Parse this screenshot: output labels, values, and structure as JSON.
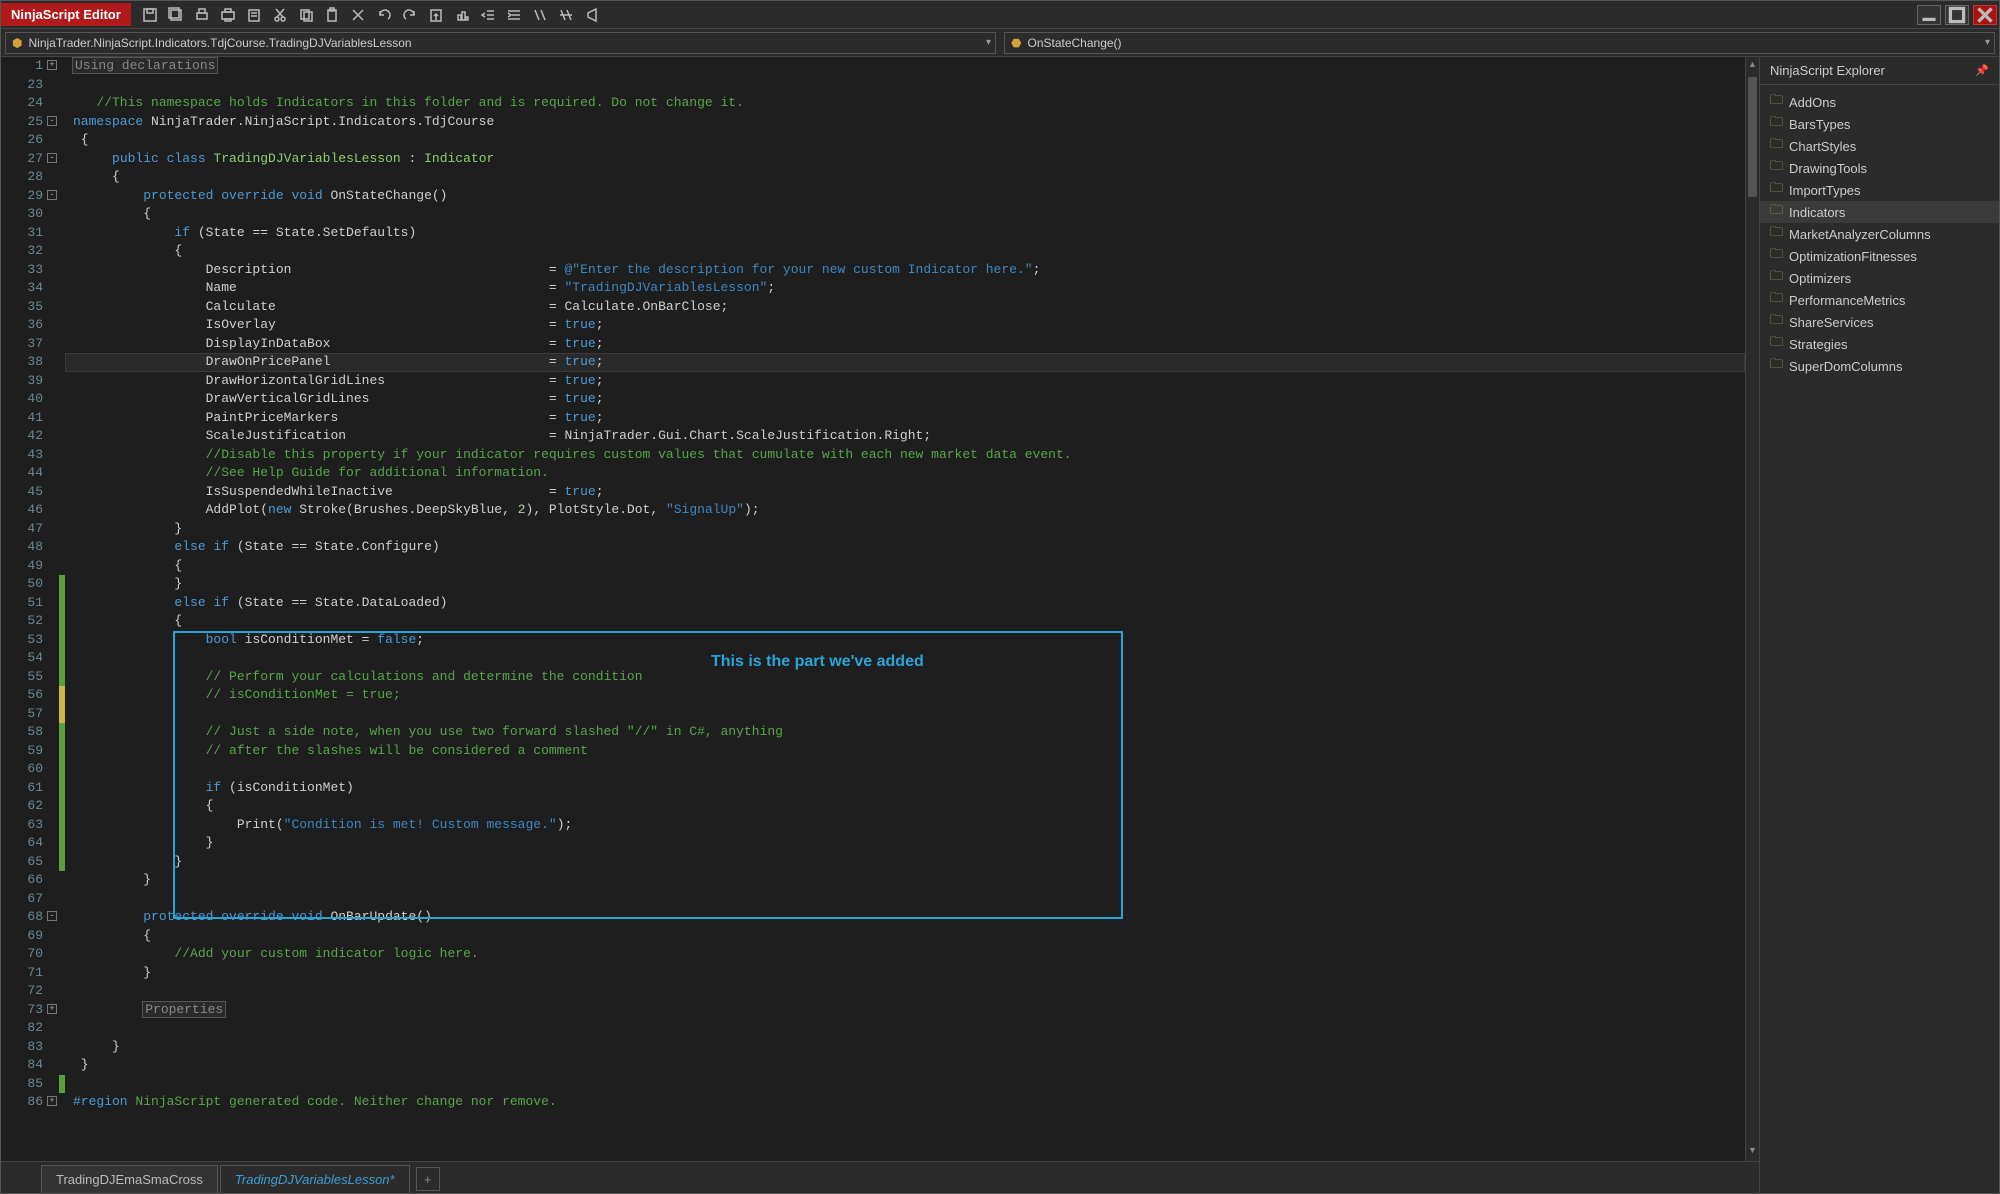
{
  "app": {
    "title": "NinjaScript Editor"
  },
  "toolbar_icons": [
    "save-icon",
    "save-all-icon",
    "print-icon",
    "print-preview-icon",
    "paste-icon",
    "cut-icon",
    "copy-icon",
    "clipboard-icon",
    "delete-icon",
    "undo-icon",
    "redo-icon",
    "export-icon",
    "build-icon",
    "outdent-icon",
    "indent-icon",
    "comment-icon",
    "uncomment-icon",
    "visualstudio-icon"
  ],
  "dropdowns": {
    "namespace": "NinjaTrader.NinjaScript.Indicators.TdjCourse.TradingDJVariablesLesson",
    "method": "OnStateChange()"
  },
  "explorer": {
    "title": "NinjaScript Explorer",
    "items": [
      {
        "label": "AddOns"
      },
      {
        "label": "BarsTypes"
      },
      {
        "label": "ChartStyles"
      },
      {
        "label": "DrawingTools"
      },
      {
        "label": "ImportTypes"
      },
      {
        "label": "Indicators",
        "selected": true
      },
      {
        "label": "MarketAnalyzerColumns"
      },
      {
        "label": "OptimizationFitnesses"
      },
      {
        "label": "Optimizers"
      },
      {
        "label": "PerformanceMetrics"
      },
      {
        "label": "ShareServices"
      },
      {
        "label": "Strategies"
      },
      {
        "label": "SuperDomColumns"
      }
    ]
  },
  "tabs": [
    {
      "label": "TradingDJEmaSmaCross",
      "active": false
    },
    {
      "label": "TradingDJVariablesLesson*",
      "active": true
    }
  ],
  "annotation": {
    "label": "This is the part we've added"
  },
  "code": {
    "start_line": 1,
    "lines": [
      {
        "n": 1,
        "fold": "+",
        "html": "<span class='boxed'>Using declarations</span>"
      },
      {
        "n": 23,
        "html": ""
      },
      {
        "n": 24,
        "html": "   <span class='cm'>//This namespace holds Indicators in this folder and is required. Do not change it.</span>"
      },
      {
        "n": 25,
        "fold": "-",
        "html": "<span class='bluekw'>namespace</span> NinjaTrader.NinjaScript.Indicators.TdjCourse"
      },
      {
        "n": 26,
        "html": " {"
      },
      {
        "n": 27,
        "fold": "-",
        "html": "     <span class='bluekw'>public class</span> <span class='type'>TradingDJVariablesLesson</span> : <span class='type'>Indicator</span>"
      },
      {
        "n": 28,
        "html": "     {"
      },
      {
        "n": 29,
        "fold": "-",
        "html": "         <span class='bluekw'>protected override void</span> OnStateChange()"
      },
      {
        "n": 30,
        "html": "         {"
      },
      {
        "n": 31,
        "html": "             <span class='bluekw'>if</span> (State == State.SetDefaults)"
      },
      {
        "n": 32,
        "html": "             {"
      },
      {
        "n": 33,
        "html": "                 Description                                 = <span class='strblue'>@\"Enter the description for your new custom Indicator here.\"</span>;"
      },
      {
        "n": 34,
        "html": "                 Name                                        = <span class='strblue'>\"TradingDJVariablesLesson\"</span>;"
      },
      {
        "n": 35,
        "html": "                 Calculate                                   = Calculate.OnBarClose;"
      },
      {
        "n": 36,
        "html": "                 IsOverlay                                   = <span class='bluekw'>true</span>;"
      },
      {
        "n": 37,
        "html": "                 DisplayInDataBox                            = <span class='bluekw'>true</span>;"
      },
      {
        "n": 38,
        "hl": true,
        "html": "                 DrawOnPricePanel                            = <span class='bluekw'>true</span>;"
      },
      {
        "n": 39,
        "html": "                 DrawHorizontalGridLines                     = <span class='bluekw'>true</span>;"
      },
      {
        "n": 40,
        "html": "                 DrawVerticalGridLines                       = <span class='bluekw'>true</span>;"
      },
      {
        "n": 41,
        "html": "                 PaintPriceMarkers                           = <span class='bluekw'>true</span>;"
      },
      {
        "n": 42,
        "html": "                 ScaleJustification                          = NinjaTrader.Gui.Chart.ScaleJustification.Right;"
      },
      {
        "n": 43,
        "html": "                 <span class='cm'>//Disable this property if your indicator requires custom values that cumulate with each new market data event.</span>"
      },
      {
        "n": 44,
        "html": "                 <span class='cm'>//See Help Guide for additional information.</span>"
      },
      {
        "n": 45,
        "html": "                 IsSuspendedWhileInactive                    = <span class='bluekw'>true</span>;"
      },
      {
        "n": 46,
        "html": "                 AddPlot(<span class='bluekw'>new</span> Stroke(Brushes.DeepSkyBlue, <span class='num'>2</span>), PlotStyle.Dot, <span class='strblue'>\"SignalUp\"</span>);"
      },
      {
        "n": 47,
        "html": "             }"
      },
      {
        "n": 48,
        "html": "             <span class='bluekw'>else if</span> (State == State.Configure)"
      },
      {
        "n": 49,
        "html": "             {"
      },
      {
        "n": 50,
        "mark": "green",
        "html": "             }"
      },
      {
        "n": 51,
        "mark": "green",
        "html": "             <span class='bluekw'>else if</span> (State == State.DataLoaded)"
      },
      {
        "n": 52,
        "mark": "green",
        "html": "             {"
      },
      {
        "n": 53,
        "mark": "green",
        "html": "                 <span class='bluekw'>bool</span> isConditionMet = <span class='bluekw'>false</span>;"
      },
      {
        "n": 54,
        "mark": "green",
        "html": ""
      },
      {
        "n": 55,
        "mark": "green",
        "html": "                 <span class='cm'>// Perform your calculations and determine the condition</span>"
      },
      {
        "n": 56,
        "mark": "yellow",
        "html": "                 <span class='cm'>// isConditionMet = true;</span>"
      },
      {
        "n": 57,
        "mark": "yellow",
        "html": ""
      },
      {
        "n": 58,
        "mark": "green",
        "html": "                 <span class='cm'>// Just a side note, when you use two forward slashed \"//\" in C#, anything</span>"
      },
      {
        "n": 59,
        "mark": "green",
        "html": "                 <span class='cm'>// after the slashes will be considered a comment</span>"
      },
      {
        "n": 60,
        "mark": "green",
        "html": ""
      },
      {
        "n": 61,
        "mark": "green",
        "html": "                 <span class='bluekw'>if</span> (isConditionMet)"
      },
      {
        "n": 62,
        "mark": "green",
        "html": "                 {"
      },
      {
        "n": 63,
        "mark": "green",
        "html": "                     Print(<span class='strblue'>\"Condition is met! Custom message.\"</span>);"
      },
      {
        "n": 64,
        "mark": "green",
        "html": "                 }"
      },
      {
        "n": 65,
        "mark": "green",
        "html": "             }"
      },
      {
        "n": 66,
        "html": "         }"
      },
      {
        "n": 67,
        "html": ""
      },
      {
        "n": 68,
        "fold": "-",
        "html": "         <span class='bluekw'>protected override void</span> OnBarUpdate()"
      },
      {
        "n": 69,
        "html": "         {"
      },
      {
        "n": 70,
        "html": "             <span class='cm'>//Add your custom indicator logic here.</span>"
      },
      {
        "n": 71,
        "html": "         }"
      },
      {
        "n": 72,
        "html": ""
      },
      {
        "n": 73,
        "fold": "+",
        "html": "         <span class='boxed'>Properties</span>"
      },
      {
        "n": 82,
        "html": ""
      },
      {
        "n": 83,
        "html": "     }"
      },
      {
        "n": 84,
        "html": " }"
      },
      {
        "n": 85,
        "mark": "green",
        "html": ""
      },
      {
        "n": 86,
        "fold": "+",
        "html": "<span class='bluekw'>#region</span> <span class='cm'>NinjaScript generated code. Neither change nor remove.</span>"
      }
    ]
  }
}
